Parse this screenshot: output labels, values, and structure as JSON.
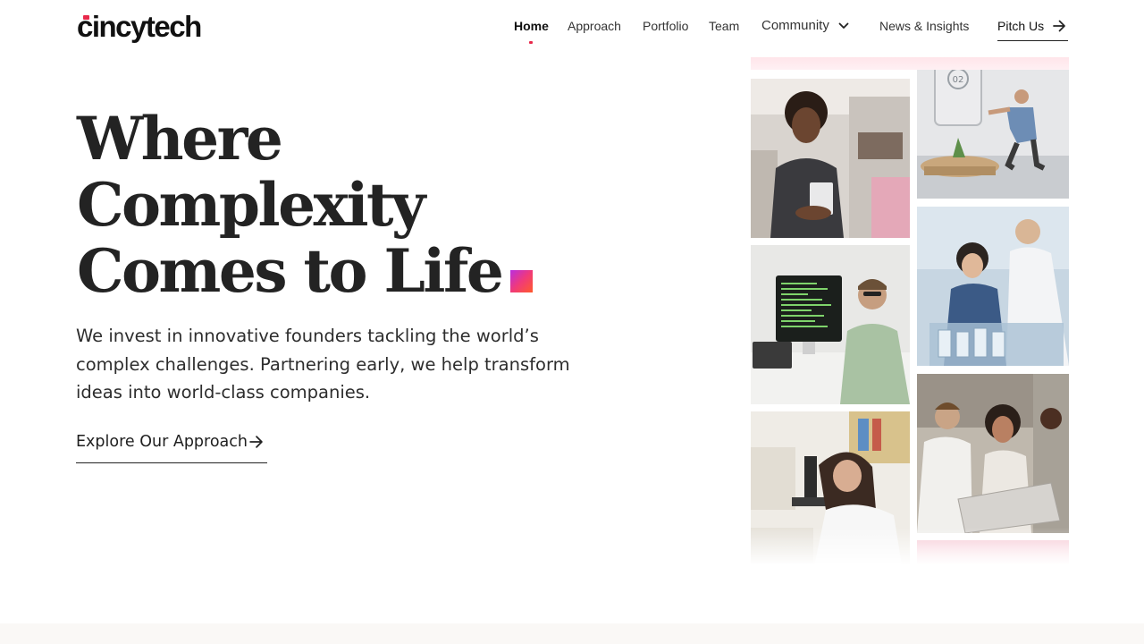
{
  "brand": {
    "logo_text": "cincytech",
    "accent": "#e8294b"
  },
  "nav": {
    "items": [
      {
        "label": "Home",
        "active": true
      },
      {
        "label": "Approach"
      },
      {
        "label": "Portfolio"
      },
      {
        "label": "Team"
      },
      {
        "label": "Community",
        "dropdown": true
      },
      {
        "label": "News & Insights"
      }
    ],
    "pitch_label": "Pitch Us"
  },
  "hero": {
    "title_lines": [
      "Where",
      "Complexity",
      "Comes to Life"
    ],
    "description": "We invest in innovative founders tackling the world’s complex challenges. Partnering early, we help transform ideas into world-class companies.",
    "cta_label": "Explore Our Approach"
  },
  "gallery": {
    "photos": [
      {
        "name": "teacher-photo"
      },
      {
        "name": "fitness-photo",
        "badge": "02"
      },
      {
        "name": "developer-photo"
      },
      {
        "name": "lab-team-photo"
      },
      {
        "name": "scientist-microscope-photo"
      },
      {
        "name": "collaboration-photo"
      }
    ]
  },
  "icons": {
    "arrow": "arrow-right-icon",
    "chevron": "chevron-down-icon"
  }
}
